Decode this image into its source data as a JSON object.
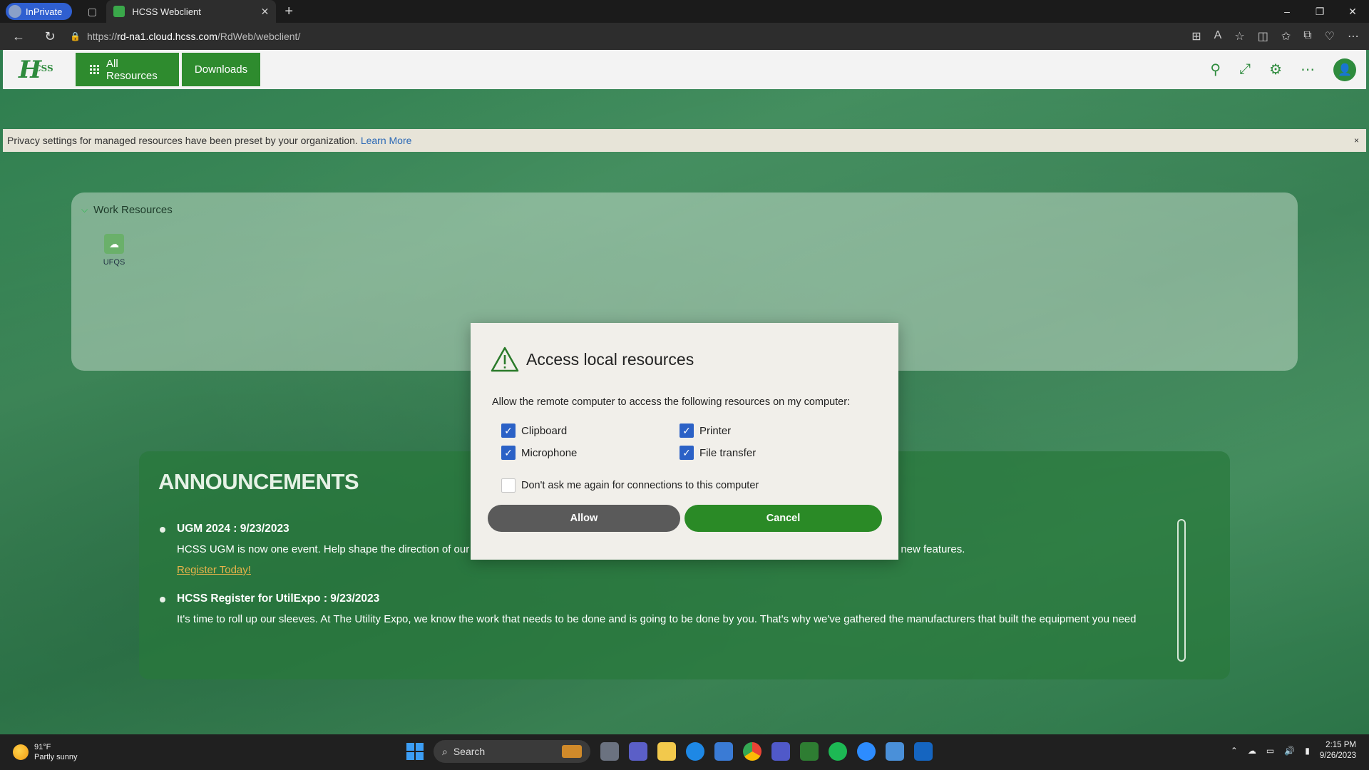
{
  "browser": {
    "inprivate_label": "InPrivate",
    "tab_title": "HCSS Webclient",
    "url_prefix": "https://",
    "url_host": "rd-na1.cloud.hcss.com",
    "url_path": "/RdWeb/webclient/"
  },
  "app": {
    "logo_text": "H",
    "logo_sup": "CSS",
    "nav": {
      "all_resources": "All Resources",
      "downloads": "Downloads"
    }
  },
  "notice": {
    "text": "Privacy settings for managed resources have been preset by your organization.",
    "link": "Learn More",
    "close": "×"
  },
  "work_resources": {
    "heading": "Work Resources",
    "items": [
      {
        "label": "UFQS"
      }
    ]
  },
  "announcements": {
    "heading": "ANNOUNCEMENTS",
    "items": [
      {
        "title": "UGM 2024 : 9/23/2023",
        "body": "HCSS UGM is now one event. Help shape the direction of our products by joining our townhalls! Take the opportunity to share your thoughts and vote on new features.",
        "link": "Register Today!"
      },
      {
        "title": "HCSS Register for UtilExpo : 9/23/2023",
        "body": "It's time to roll up our sleeves. At The Utility Expo, we know the work that needs to be done and is going to be done by you. That's why we've gathered the manufacturers that built the equipment you need"
      }
    ]
  },
  "dialog": {
    "title": "Access local resources",
    "description": "Allow the remote computer to access the following resources on my computer:",
    "options": {
      "clipboard": {
        "label": "Clipboard",
        "checked": true
      },
      "printer": {
        "label": "Printer",
        "checked": true
      },
      "microphone": {
        "label": "Microphone",
        "checked": true
      },
      "file_transfer": {
        "label": "File transfer",
        "checked": true
      }
    },
    "dont_ask": {
      "label": "Don't ask me again for connections to this computer",
      "checked": false
    },
    "allow_label": "Allow",
    "cancel_label": "Cancel"
  },
  "taskbar": {
    "temperature": "91°F",
    "weather": "Partly sunny",
    "search_label": "Search",
    "time": "2:15 PM",
    "date": "9/26/2023"
  },
  "colors": {
    "accent_green": "#2e8b2e",
    "checkbox_blue": "#2b61c6",
    "allow_gray": "#5a5a5a"
  }
}
